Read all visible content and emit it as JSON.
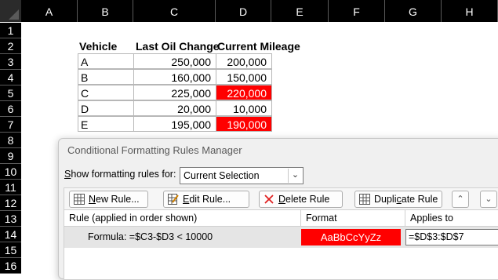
{
  "sheet": {
    "columns": [
      "A",
      "B",
      "C",
      "D",
      "E",
      "F",
      "G",
      "H"
    ],
    "rows": [
      "1",
      "2",
      "3",
      "4",
      "5",
      "6",
      "7",
      "8",
      "9",
      "10",
      "11",
      "12",
      "13",
      "14",
      "15",
      "16"
    ],
    "headers": {
      "vehicle": "Vehicle",
      "last_oil_change": "Last Oil Change",
      "current_mileage": "Current Mileage"
    },
    "data": [
      {
        "vehicle": "A",
        "last_oil_change": "250,000",
        "current_mileage": "200,000",
        "highlight": false
      },
      {
        "vehicle": "B",
        "last_oil_change": "160,000",
        "current_mileage": "150,000",
        "highlight": false
      },
      {
        "vehicle": "C",
        "last_oil_change": "225,000",
        "current_mileage": "220,000",
        "highlight": true
      },
      {
        "vehicle": "D",
        "last_oil_change": "20,000",
        "current_mileage": "10,000",
        "highlight": false
      },
      {
        "vehicle": "E",
        "last_oil_change": "195,000",
        "current_mileage": "190,000",
        "highlight": true
      }
    ],
    "highlight_color": "#ff0000"
  },
  "dialog": {
    "title": "Conditional Formatting Rules Manager",
    "show_label_underlined": "S",
    "show_label_rest": "how formatting rules for:",
    "show_value": "Current Selection",
    "buttons": {
      "new_rule_u": "N",
      "new_rule_rest": "ew Rule...",
      "edit_rule_u": "E",
      "edit_rule_rest": "dit Rule...",
      "delete_rule_u": "D",
      "delete_rule_rest": "elete Rule",
      "duplicate_rule_pre": "Dupli",
      "duplicate_rule_u": "c",
      "duplicate_rule_rest": "ate Rule"
    },
    "table": {
      "col_rule": "Rule (applied in order shown)",
      "col_format": "Format",
      "col_applies": "Applies to",
      "rule_formula": "Formula: =$C3-$D3 < 10000",
      "rule_format_preview": "AaBbCcYyZz",
      "rule_applies_to": "=$D$3:$D$7"
    }
  }
}
